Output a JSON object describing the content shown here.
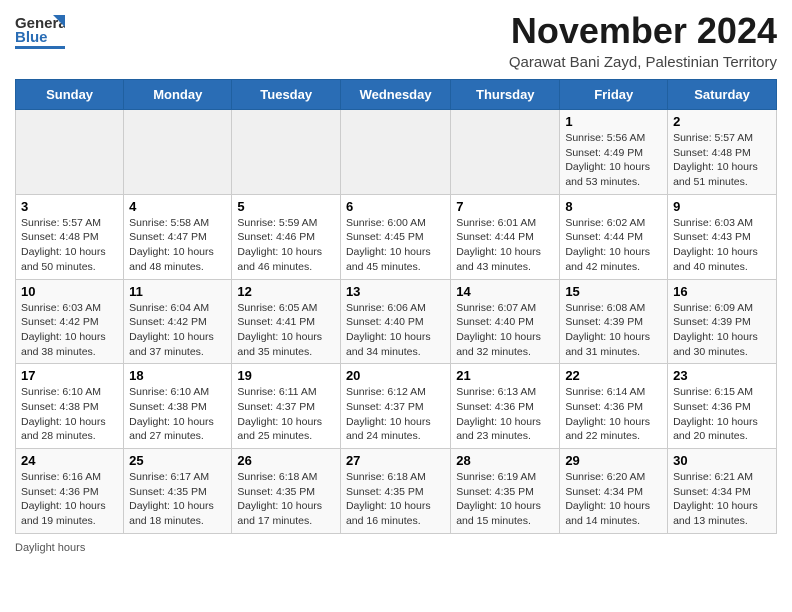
{
  "header": {
    "logo_general": "General",
    "logo_blue": "Blue",
    "month_title": "November 2024",
    "location": "Qarawat Bani Zayd, Palestinian Territory"
  },
  "weekdays": [
    "Sunday",
    "Monday",
    "Tuesday",
    "Wednesday",
    "Thursday",
    "Friday",
    "Saturday"
  ],
  "weeks": [
    [
      {
        "day": "",
        "info": ""
      },
      {
        "day": "",
        "info": ""
      },
      {
        "day": "",
        "info": ""
      },
      {
        "day": "",
        "info": ""
      },
      {
        "day": "",
        "info": ""
      },
      {
        "day": "1",
        "info": "Sunrise: 5:56 AM\nSunset: 4:49 PM\nDaylight: 10 hours and 53 minutes."
      },
      {
        "day": "2",
        "info": "Sunrise: 5:57 AM\nSunset: 4:48 PM\nDaylight: 10 hours and 51 minutes."
      }
    ],
    [
      {
        "day": "3",
        "info": "Sunrise: 5:57 AM\nSunset: 4:48 PM\nDaylight: 10 hours and 50 minutes."
      },
      {
        "day": "4",
        "info": "Sunrise: 5:58 AM\nSunset: 4:47 PM\nDaylight: 10 hours and 48 minutes."
      },
      {
        "day": "5",
        "info": "Sunrise: 5:59 AM\nSunset: 4:46 PM\nDaylight: 10 hours and 46 minutes."
      },
      {
        "day": "6",
        "info": "Sunrise: 6:00 AM\nSunset: 4:45 PM\nDaylight: 10 hours and 45 minutes."
      },
      {
        "day": "7",
        "info": "Sunrise: 6:01 AM\nSunset: 4:44 PM\nDaylight: 10 hours and 43 minutes."
      },
      {
        "day": "8",
        "info": "Sunrise: 6:02 AM\nSunset: 4:44 PM\nDaylight: 10 hours and 42 minutes."
      },
      {
        "day": "9",
        "info": "Sunrise: 6:03 AM\nSunset: 4:43 PM\nDaylight: 10 hours and 40 minutes."
      }
    ],
    [
      {
        "day": "10",
        "info": "Sunrise: 6:03 AM\nSunset: 4:42 PM\nDaylight: 10 hours and 38 minutes."
      },
      {
        "day": "11",
        "info": "Sunrise: 6:04 AM\nSunset: 4:42 PM\nDaylight: 10 hours and 37 minutes."
      },
      {
        "day": "12",
        "info": "Sunrise: 6:05 AM\nSunset: 4:41 PM\nDaylight: 10 hours and 35 minutes."
      },
      {
        "day": "13",
        "info": "Sunrise: 6:06 AM\nSunset: 4:40 PM\nDaylight: 10 hours and 34 minutes."
      },
      {
        "day": "14",
        "info": "Sunrise: 6:07 AM\nSunset: 4:40 PM\nDaylight: 10 hours and 32 minutes."
      },
      {
        "day": "15",
        "info": "Sunrise: 6:08 AM\nSunset: 4:39 PM\nDaylight: 10 hours and 31 minutes."
      },
      {
        "day": "16",
        "info": "Sunrise: 6:09 AM\nSunset: 4:39 PM\nDaylight: 10 hours and 30 minutes."
      }
    ],
    [
      {
        "day": "17",
        "info": "Sunrise: 6:10 AM\nSunset: 4:38 PM\nDaylight: 10 hours and 28 minutes."
      },
      {
        "day": "18",
        "info": "Sunrise: 6:10 AM\nSunset: 4:38 PM\nDaylight: 10 hours and 27 minutes."
      },
      {
        "day": "19",
        "info": "Sunrise: 6:11 AM\nSunset: 4:37 PM\nDaylight: 10 hours and 25 minutes."
      },
      {
        "day": "20",
        "info": "Sunrise: 6:12 AM\nSunset: 4:37 PM\nDaylight: 10 hours and 24 minutes."
      },
      {
        "day": "21",
        "info": "Sunrise: 6:13 AM\nSunset: 4:36 PM\nDaylight: 10 hours and 23 minutes."
      },
      {
        "day": "22",
        "info": "Sunrise: 6:14 AM\nSunset: 4:36 PM\nDaylight: 10 hours and 22 minutes."
      },
      {
        "day": "23",
        "info": "Sunrise: 6:15 AM\nSunset: 4:36 PM\nDaylight: 10 hours and 20 minutes."
      }
    ],
    [
      {
        "day": "24",
        "info": "Sunrise: 6:16 AM\nSunset: 4:36 PM\nDaylight: 10 hours and 19 minutes."
      },
      {
        "day": "25",
        "info": "Sunrise: 6:17 AM\nSunset: 4:35 PM\nDaylight: 10 hours and 18 minutes."
      },
      {
        "day": "26",
        "info": "Sunrise: 6:18 AM\nSunset: 4:35 PM\nDaylight: 10 hours and 17 minutes."
      },
      {
        "day": "27",
        "info": "Sunrise: 6:18 AM\nSunset: 4:35 PM\nDaylight: 10 hours and 16 minutes."
      },
      {
        "day": "28",
        "info": "Sunrise: 6:19 AM\nSunset: 4:35 PM\nDaylight: 10 hours and 15 minutes."
      },
      {
        "day": "29",
        "info": "Sunrise: 6:20 AM\nSunset: 4:34 PM\nDaylight: 10 hours and 14 minutes."
      },
      {
        "day": "30",
        "info": "Sunrise: 6:21 AM\nSunset: 4:34 PM\nDaylight: 10 hours and 13 minutes."
      }
    ]
  ],
  "footer": {
    "daylight_hours": "Daylight hours"
  }
}
